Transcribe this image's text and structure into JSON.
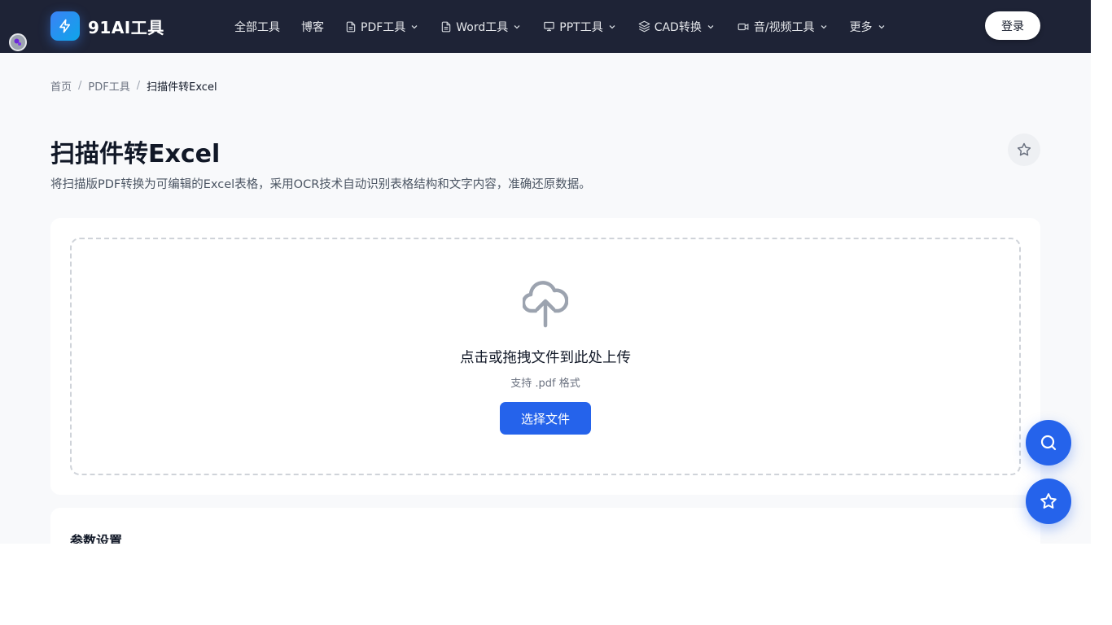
{
  "header": {
    "logo_text": "91AI工具",
    "nav": [
      {
        "label": "全部工具"
      },
      {
        "label": "博客"
      },
      {
        "label": "PDF工具"
      },
      {
        "label": "Word工具"
      },
      {
        "label": "PPT工具"
      },
      {
        "label": "CAD转换"
      },
      {
        "label": "音/视频工具"
      },
      {
        "label": "更多"
      }
    ],
    "login_label": "登录"
  },
  "breadcrumb": {
    "items": [
      "首页",
      "PDF工具",
      "扫描件转Excel"
    ],
    "separator": "/"
  },
  "page": {
    "title": "扫描件转Excel",
    "description": "将扫描版PDF转换为可编辑的Excel表格，采用OCR技术自动识别表格结构和文字内容，准确还原数据。"
  },
  "upload": {
    "title": "点击或拖拽文件到此处上传",
    "hint": "支持 .pdf 格式",
    "button_label": "选择文件"
  },
  "params": {
    "title": "参数设置"
  },
  "colors": {
    "header_bg": "#1e2336",
    "accent": "#2563eb",
    "page_bg": "#f8f9fb"
  },
  "icons": {
    "logo": "lightning-icon",
    "favorite": "star-icon",
    "upload": "cloud-upload-icon",
    "fab_search": "search-icon",
    "fab_star": "star-icon"
  }
}
